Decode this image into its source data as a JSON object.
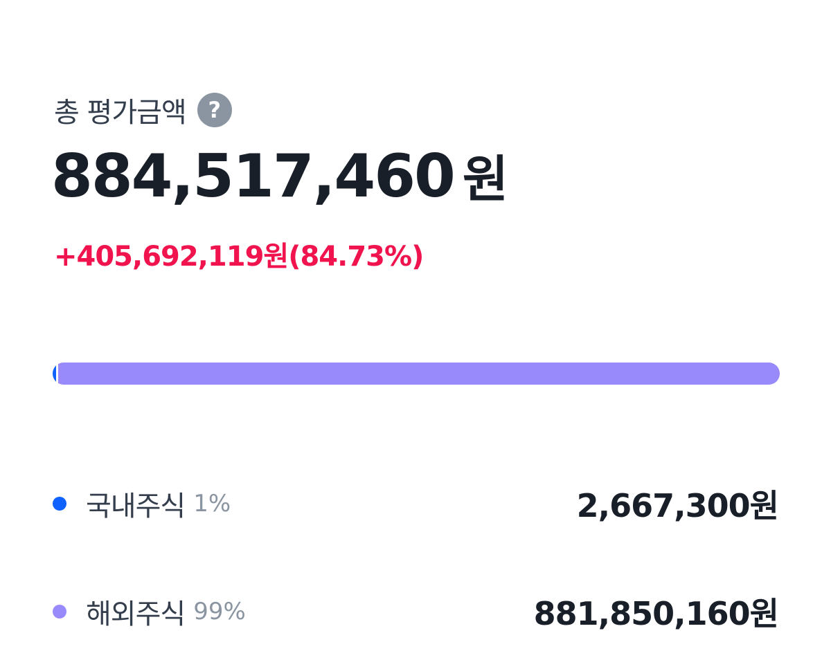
{
  "summary": {
    "title": "총 평가금액",
    "help_icon": "question-mark-icon",
    "total_number": "884,517,460",
    "total_unit": "원",
    "profit_text": "+405,692,119원(84.73%)",
    "profit_color": "#f0134d"
  },
  "allocation_bar": {
    "segments": [
      {
        "name": "국내주식",
        "share_percent": 0.3,
        "color": "#0f62fe"
      },
      {
        "name": "해외주식",
        "share_percent": 99.7,
        "color": "#998afb"
      }
    ]
  },
  "holdings": [
    {
      "name": "국내주식",
      "percent": "1%",
      "value": "2,667,300원",
      "color": "#0f62fe"
    },
    {
      "name": "해외주식",
      "percent": "99%",
      "value": "881,850,160원",
      "color": "#998afb"
    }
  ]
}
